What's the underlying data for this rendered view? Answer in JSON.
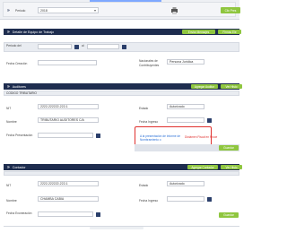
{
  "period": {
    "label": "Periodo",
    "value": "2018"
  },
  "top_button": "Clic Pres",
  "team": {
    "title": "Detalle de Equipo de Trabajo",
    "buttons": [
      "Enviar Mensajes",
      "Firmas Ele"
    ],
    "period_from_label": "Periodo del",
    "period_to_label": "al",
    "creation_date_label": "Fecha Creación",
    "taxpayers_label": "Nacionales de Contribuyentes",
    "taxpayer_type": "Persona Jurídica"
  },
  "auditor": {
    "title": "Auditores",
    "buttons": [
      "Agregar Auditor",
      "Ver Histo"
    ],
    "subheader": "CODIGO TRIBUTARIO",
    "nit_label": "NIT",
    "nit_value": "2222-222222-222-1",
    "status_label": "Estado",
    "status_value": "Autorizado",
    "name_label": "Nombre",
    "name_value": "TRIBUTARIO AUDITORES C/A",
    "date_in_label": "Fecha Ingreso",
    "date_label": "Fecha Presentación",
    "link_text": "A la presentación de Informe de Nombramiento o",
    "warning_text": "Dictámen Fiscal en Proce",
    "action_button": "Guardar"
  },
  "contador": {
    "title": "Contador",
    "buttons": [
      "Agregar Contador",
      "Ver Histo"
    ],
    "nit_label": "NIT",
    "nit_value": "2222-222222-222-1",
    "status_label": "Estado",
    "status_value": "Autorizado",
    "name_label": "Nombre",
    "name_value": "CHAMBA CABIA",
    "date_in_label": "Fecha Ingreso",
    "date_label": "Fecha Exoneración",
    "action_button": "Guardar"
  },
  "colors": {
    "navy": "#1e2d4f",
    "green": "#8fc63f",
    "red": "#e0312f"
  }
}
